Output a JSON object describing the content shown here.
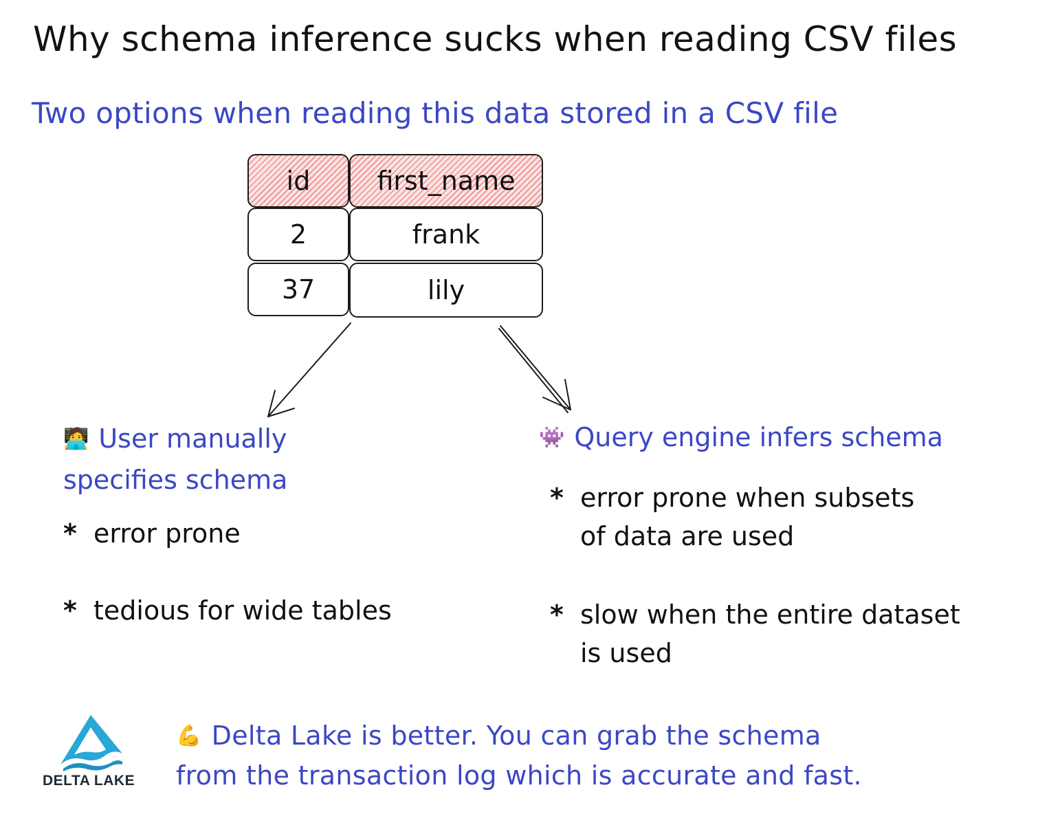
{
  "title": "Why schema inference sucks when reading CSV files",
  "subtitle": "Two options when reading this data stored in a CSV file",
  "table": {
    "headers": [
      "id",
      "first_name"
    ],
    "rows": [
      [
        "2",
        "frank"
      ],
      [
        "37",
        "lily"
      ]
    ]
  },
  "left_option": {
    "emoji": "🧑‍💻",
    "heading_line1": "User manually",
    "heading_line2": "specifies schema",
    "bullets": [
      "error prone",
      "tedious for wide tables"
    ]
  },
  "right_option": {
    "emoji": "👾",
    "heading": "Query engine infers schema",
    "bullet1_line1": "error prone when subsets",
    "bullet1_line2": "of data are used",
    "bullet2_line1": "slow when the entire dataset",
    "bullet2_line2": "is used"
  },
  "bullet_marker": "*",
  "footer": {
    "logo_text": "DELTA LAKE",
    "emoji": "💪",
    "line1": "Delta Lake is better.  You can grab the schema",
    "line2": "from the transaction log which is accurate and fast."
  },
  "colors": {
    "accent_blue": "#3b47c4",
    "header_hatch": "#e04848",
    "delta_teal": "#29a7d7",
    "ink": "#111111"
  }
}
